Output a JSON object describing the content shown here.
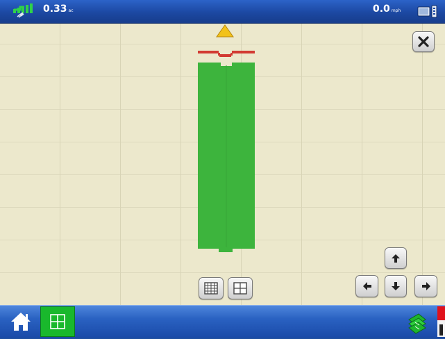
{
  "status_bar": {
    "area_value": "0.33",
    "area_unit": "ac",
    "speed_value": "0.0",
    "speed_unit": "mph"
  },
  "colors": {
    "coverage": "#3db43d",
    "vehicle_marker": "#f2c21a",
    "implement_bar": "#d23a32",
    "topbar": "#1c48a2",
    "map_background": "#ece8cc"
  },
  "icons": {
    "gps": "gps-satellite-icon",
    "display": "display-settings-icon",
    "close": "close-icon",
    "grid_fine": "grid-fine-icon",
    "grid_coarse": "grid-coarse-icon",
    "pan_up": "arrow-up-icon",
    "pan_left": "arrow-left-icon",
    "pan_down": "arrow-down-icon",
    "pan_right": "arrow-right-icon",
    "home": "home-icon",
    "map_view": "map-grid-icon",
    "field": "field-coverage-icon"
  }
}
